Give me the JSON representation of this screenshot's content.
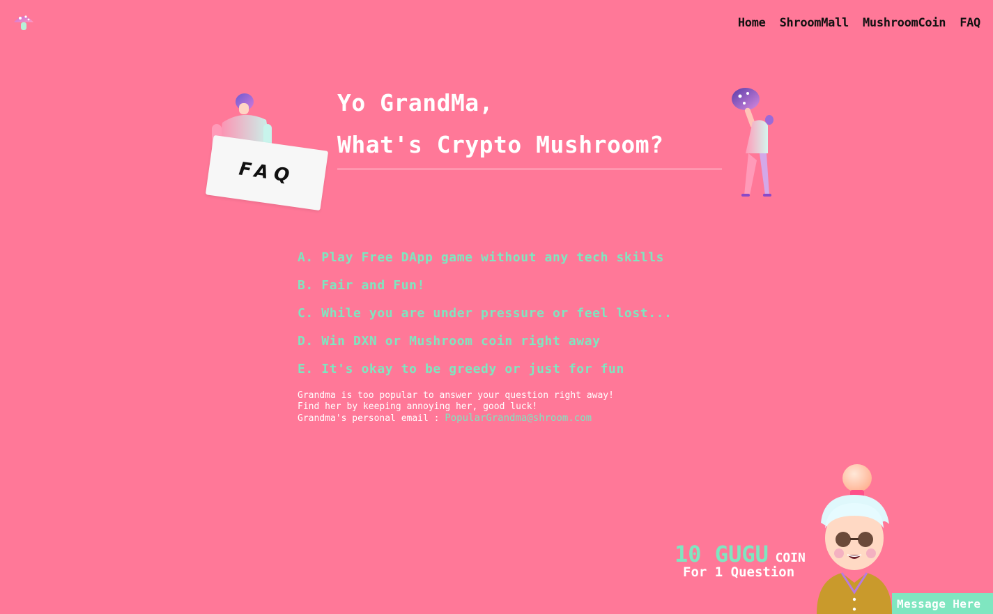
{
  "nav": {
    "logo_icon": "mushroom-icon",
    "items": [
      {
        "label": "Home"
      },
      {
        "label": "ShroomMall"
      },
      {
        "label": "MushroomCoin"
      },
      {
        "label": "FAQ"
      }
    ]
  },
  "hero": {
    "title_line1": "Yo GrandMa,",
    "title_line2": "What's Crypto Mushroom?",
    "card_label": "FAQ"
  },
  "features": [
    "A. Play Free DApp game without any tech skills",
    "B. Fair and Fun!",
    "C. While you are under pressure or feel lost...",
    "D. Win DXN or Mushroom coin right away",
    "E. It's okay to be greedy or just for fun"
  ],
  "notes": {
    "line1": "Grandma is too popular to answer your question right away!",
    "line2": "Find her by keeping annoying her, good luck!",
    "email_label": "Grandma's personal email : ",
    "email": "PopularGrandma@shroom.com"
  },
  "coin": {
    "amount": "10 GUGU",
    "unit": "COIN",
    "sub": "For 1 Question"
  },
  "message_button": "Message Here",
  "colors": {
    "background": "#ff7898",
    "accent": "#7fe6c0"
  }
}
